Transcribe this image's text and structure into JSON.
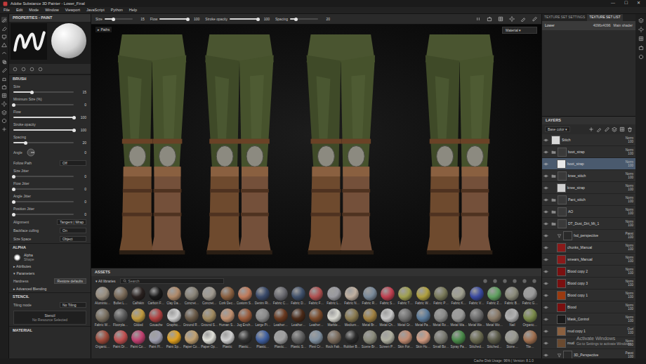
{
  "window": {
    "title": "Adobe Substance 3D Painter - Lower_Final",
    "controls": [
      "—",
      "☐",
      "✕"
    ]
  },
  "menu": [
    "File",
    "Edit",
    "Mode",
    "Window",
    "Viewport",
    "JavaScript",
    "Python",
    "Help"
  ],
  "toolbar": [
    {
      "label": "Size",
      "value": "15",
      "level": 0.3
    },
    {
      "label": "Flow",
      "value": "100",
      "level": 1
    },
    {
      "label": "Stroke opacity",
      "value": "100",
      "level": 1
    },
    {
      "label": "Spacing",
      "value": "20",
      "level": 0.2
    }
  ],
  "properties": {
    "title": "PROPERTIES - PAINT",
    "brush": {
      "title": "BRUSH",
      "rows": [
        {
          "kind": "slider",
          "label": "Size",
          "value": "15",
          "level": 0.3
        },
        {
          "kind": "slider",
          "label": "Minimum Size (%)",
          "value": "0",
          "level": 0
        },
        {
          "kind": "slider",
          "label": "Flow",
          "value": "100",
          "level": 1
        },
        {
          "kind": "slider",
          "label": "Stroke opacity",
          "value": "100",
          "level": 1
        },
        {
          "kind": "slider",
          "label": "Spacing",
          "value": "20",
          "level": 0.2
        },
        {
          "kind": "angle",
          "label": "Angle",
          "value": "0",
          "level": 0
        },
        {
          "kind": "field",
          "label": "Follow Path",
          "value": "Off"
        },
        {
          "kind": "slider",
          "label": "Size Jitter",
          "value": "0",
          "level": 0
        },
        {
          "kind": "slider",
          "label": "Flow Jitter",
          "value": "0",
          "level": 0
        },
        {
          "kind": "slider",
          "label": "Angle Jitter",
          "value": "0",
          "level": 0
        },
        {
          "kind": "slider",
          "label": "Position Jitter",
          "value": "0",
          "level": 0
        },
        {
          "kind": "field",
          "label": "Alignment",
          "value": "Tangent | Wrap"
        },
        {
          "kind": "field",
          "label": "Backface culling",
          "value": "On"
        },
        {
          "kind": "field",
          "label": "Size Space",
          "value": "Object"
        }
      ]
    },
    "alpha": {
      "title": "ALPHA",
      "name": "Alpha",
      "shape": "Shape",
      "attributes": "Attributes",
      "parameters": "Parameters",
      "hardness": "Hardness",
      "restore": "Restore defaults",
      "advanced": "Advanced Blending"
    },
    "stencil": {
      "title": "STENCIL",
      "tiling_label": "Tiling mode",
      "tiling_value": "No Tiling",
      "stencil_label": "Stencil",
      "stencil_value": "No Resource Selected"
    },
    "material": {
      "title": "MATERIAL"
    }
  },
  "viewport": {
    "label": "Paths",
    "mode": "Material"
  },
  "assets": {
    "title": "ASSETS",
    "library": "All libraries",
    "search": {
      "placeholder": "Search"
    },
    "items": [
      {
        "label": "Aluminiu…",
        "color": "#9a8f80"
      },
      {
        "label": "Bullet L…",
        "color": "#7a6a58"
      },
      {
        "label": "Calfskin",
        "color": "#2a2220"
      },
      {
        "label": "Carbon F…",
        "color": "#1a1a1a"
      },
      {
        "label": "Clay Da…",
        "color": "#b08a6a"
      },
      {
        "label": "Concret…",
        "color": "#8a8478"
      },
      {
        "label": "Concret…",
        "color": "#a09a90"
      },
      {
        "label": "Cork Dec…",
        "color": "#8a6040"
      },
      {
        "label": "Custom S…",
        "color": "#c07a5a"
      },
      {
        "label": "Denim Ri…",
        "color": "#3a4a6a"
      },
      {
        "label": "Fabric C…",
        "color": "#6a6a70"
      },
      {
        "label": "Fabric D…",
        "color": "#40506a"
      },
      {
        "label": "Fabric F…",
        "color": "#b05050"
      },
      {
        "label": "Fabric L…",
        "color": "#9a9aa0"
      },
      {
        "label": "Fabric N…",
        "color": "#c0b0a0"
      },
      {
        "label": "Fabric R…",
        "color": "#7a8a9a"
      },
      {
        "label": "Fabric S…",
        "color": "#c04050"
      },
      {
        "label": "Fabric T…",
        "color": "#a0a050"
      },
      {
        "label": "Fabric W…",
        "color": "#b0a040"
      },
      {
        "label": "Fabric P…",
        "color": "#7a7a5a"
      },
      {
        "label": "Fabric K…",
        "color": "#a0a090"
      },
      {
        "label": "Fabric V…",
        "color": "#3a4aa0"
      },
      {
        "label": "Fabric Z…",
        "color": "#60a060"
      },
      {
        "label": "Fabric B…",
        "color": "#8a8a7a"
      },
      {
        "label": "Fabric G…",
        "color": "#9a9a9a"
      },
      {
        "label": "Fabric W…",
        "color": "#7a7060"
      },
      {
        "label": "Floorpla…",
        "color": "#5a5a5a"
      },
      {
        "label": "Gilded",
        "color": "#c09a40"
      },
      {
        "label": "Gouache",
        "color": "#b04040"
      },
      {
        "label": "Graphic…",
        "color": "#d0d0d0"
      },
      {
        "label": "Ground R…",
        "color": "#6a5a48"
      },
      {
        "label": "Ground S…",
        "color": "#a08a60"
      },
      {
        "label": "Human S…",
        "color": "#c09070"
      },
      {
        "label": "Jug Ench…",
        "color": "#9a5a3a"
      },
      {
        "label": "Large Pi…",
        "color": "#8a8a8a"
      },
      {
        "label": "Leather…",
        "color": "#6a3a20"
      },
      {
        "label": "Leather…",
        "color": "#4a2a18"
      },
      {
        "label": "Leather…",
        "color": "#7a4a2a"
      },
      {
        "label": "Marble…",
        "color": "#d8d8d0"
      },
      {
        "label": "Medium…",
        "color": "#8a7a50"
      },
      {
        "label": "Metal Br…",
        "color": "#a08040"
      },
      {
        "label": "Metal Ch…",
        "color": "#c8c8c8"
      },
      {
        "label": "Metal Gr…",
        "color": "#707070"
      },
      {
        "label": "Metal Pa…",
        "color": "#5a7a9a"
      },
      {
        "label": "Metal Ro…",
        "color": "#8a8a88"
      },
      {
        "label": "Metal Wa…",
        "color": "#9a9a98"
      },
      {
        "label": "Metal We…",
        "color": "#6a6a6a"
      },
      {
        "label": "Metal Wo…",
        "color": "#8a7a68"
      },
      {
        "label": "Nail",
        "color": "#b0b0b0"
      },
      {
        "label": "Organic…",
        "color": "#7a8a4a"
      },
      {
        "label": "Organic…",
        "color": "#a04a3a"
      },
      {
        "label": "Paint Dr…",
        "color": "#c05050"
      },
      {
        "label": "Paint Co…",
        "color": "#c04070"
      },
      {
        "label": "Paint Fl…",
        "color": "#a0a0b0"
      },
      {
        "label": "Paint Sp…",
        "color": "#e0a020"
      },
      {
        "label": "Paper Co…",
        "color": "#c0a070"
      },
      {
        "label": "Paper Op…",
        "color": "#e0e0d8"
      },
      {
        "label": "Plastic",
        "color": "#d0d0d0"
      },
      {
        "label": "Plastic…",
        "color": "#303030"
      },
      {
        "label": "Plastic…",
        "color": "#4060a0"
      },
      {
        "label": "Plastic…",
        "color": "#a0a0a0"
      },
      {
        "label": "Plastic S…",
        "color": "#606060"
      },
      {
        "label": "Plexi Cr…",
        "color": "#8090a0"
      },
      {
        "label": "Rock Fab…",
        "color": "#7a6a5a"
      },
      {
        "label": "Rubber B…",
        "color": "#2a2a2a"
      },
      {
        "label": "Scene Br…",
        "color": "#8a8a7a"
      },
      {
        "label": "Screen P…",
        "color": "#b0b0a0"
      },
      {
        "label": "Skin For…",
        "color": "#c08a70"
      },
      {
        "label": "Skin Hu…",
        "color": "#d09a80"
      },
      {
        "label": "Small Bo…",
        "color": "#7a7a70"
      },
      {
        "label": "Spray Pa…",
        "color": "#4a8a4a"
      },
      {
        "label": "Stitched…",
        "color": "#6a6a50"
      },
      {
        "label": "Stitched…",
        "color": "#5a5a48"
      },
      {
        "label": "Stone…",
        "color": "#9a9a90"
      },
      {
        "label": "Tile…",
        "color": "#a07050"
      }
    ]
  },
  "texture_set": {
    "tabs": [
      {
        "label": "TEXTURE SET SETTINGS",
        "selected": false
      },
      {
        "label": "TEXTURE SET LIST",
        "selected": true
      }
    ],
    "rows": [
      {
        "name": "Lower",
        "size": "4096x4096",
        "shader": "Main shader"
      }
    ]
  },
  "layers": {
    "title": "LAYERS",
    "channel": "Base color",
    "items": [
      {
        "name": "Stitch",
        "kind": "fill",
        "child": false,
        "blend": "Norm",
        "opacity": "100",
        "color": "#d8d8d8",
        "visible": true,
        "selected": false
      },
      {
        "name": "boot_strap",
        "kind": "folder",
        "child": false,
        "blend": "Norm",
        "opacity": "100",
        "color": "#3a3a3a",
        "visible": true,
        "selected": false
      },
      {
        "name": "boot_strap",
        "kind": "fill",
        "child": true,
        "blend": "Norm",
        "opacity": "100",
        "color": "#e8e8e8",
        "visible": true,
        "selected": true
      },
      {
        "name": "knee_stitch",
        "kind": "folder",
        "child": false,
        "blend": "Norm",
        "opacity": "100",
        "color": "#3a3a3a",
        "visible": true,
        "selected": false
      },
      {
        "name": "knee_strap",
        "kind": "fill",
        "child": true,
        "blend": "Norm",
        "opacity": "100",
        "color": "#d0d0d0",
        "visible": true,
        "selected": false
      },
      {
        "name": "Pant_stitch",
        "kind": "folder",
        "child": false,
        "blend": "Norm",
        "opacity": "100",
        "color": "#3a3a3a",
        "visible": true,
        "selected": false
      },
      {
        "name": "AO",
        "kind": "folder",
        "child": false,
        "blend": "Norm",
        "opacity": "100",
        "color": "#3a3a3a",
        "visible": true,
        "selected": false
      },
      {
        "name": "DT_Dust_Dirt_Mt_1",
        "kind": "folder",
        "child": false,
        "blend": "Norm",
        "opacity": "100",
        "color": "#3a3a3a",
        "visible": true,
        "selected": false
      },
      {
        "name": "fxd_perspective",
        "kind": "filter",
        "child": true,
        "blend": "Passt",
        "opacity": "100",
        "color": "#2a2a2a",
        "visible": true,
        "selected": false
      },
      {
        "name": "chunks_Manual",
        "kind": "fill",
        "child": true,
        "blend": "Norm",
        "opacity": "100",
        "color": "#8a1a1a",
        "visible": true,
        "selected": false
      },
      {
        "name": "smears_Manual",
        "kind": "fill",
        "child": true,
        "blend": "Norm",
        "opacity": "100",
        "color": "#8a1a1a",
        "visible": true,
        "selected": false
      },
      {
        "name": "Blood copy 2",
        "kind": "fill",
        "child": true,
        "blend": "Norm",
        "opacity": "100",
        "color": "#7a1010",
        "visible": true,
        "selected": false
      },
      {
        "name": "Blood copy 3",
        "kind": "fill",
        "child": true,
        "blend": "Norm",
        "opacity": "100",
        "color": "#7a1010",
        "visible": true,
        "selected": false
      },
      {
        "name": "Blood copy 1",
        "kind": "fill",
        "child": true,
        "blend": "Norm",
        "opacity": "100",
        "color": "#9a3a10",
        "visible": true,
        "selected": false
      },
      {
        "name": "Blood",
        "kind": "fill",
        "child": true,
        "blend": "Norm",
        "opacity": "100",
        "color": "#7a1010",
        "visible": true,
        "selected": false
      },
      {
        "name": "Mask_Control",
        "kind": "fill",
        "child": true,
        "blend": "Norm",
        "opacity": "100",
        "color": "#1a1a1a",
        "visible": true,
        "selected": false
      },
      {
        "name": "mud copy 1",
        "kind": "fill",
        "child": true,
        "blend": "Ovrl",
        "opacity": "100",
        "color": "#8a6040",
        "visible": true,
        "selected": false
      },
      {
        "name": "mud",
        "kind": "fill",
        "child": true,
        "blend": "Norm",
        "opacity": "100",
        "color": "#6a4a30",
        "visible": true,
        "selected": false
      },
      {
        "name": "3D_Perspective",
        "kind": "filter",
        "child": true,
        "blend": "Passt",
        "opacity": "100",
        "color": "#2a2a2a",
        "visible": true,
        "selected": false
      }
    ]
  },
  "watermark": {
    "title": "Activate Windows",
    "subtitle": "Go to Settings to activate Windows."
  },
  "status_bar": "Cache Disk Usage: 96% | Version: 8.1.0"
}
